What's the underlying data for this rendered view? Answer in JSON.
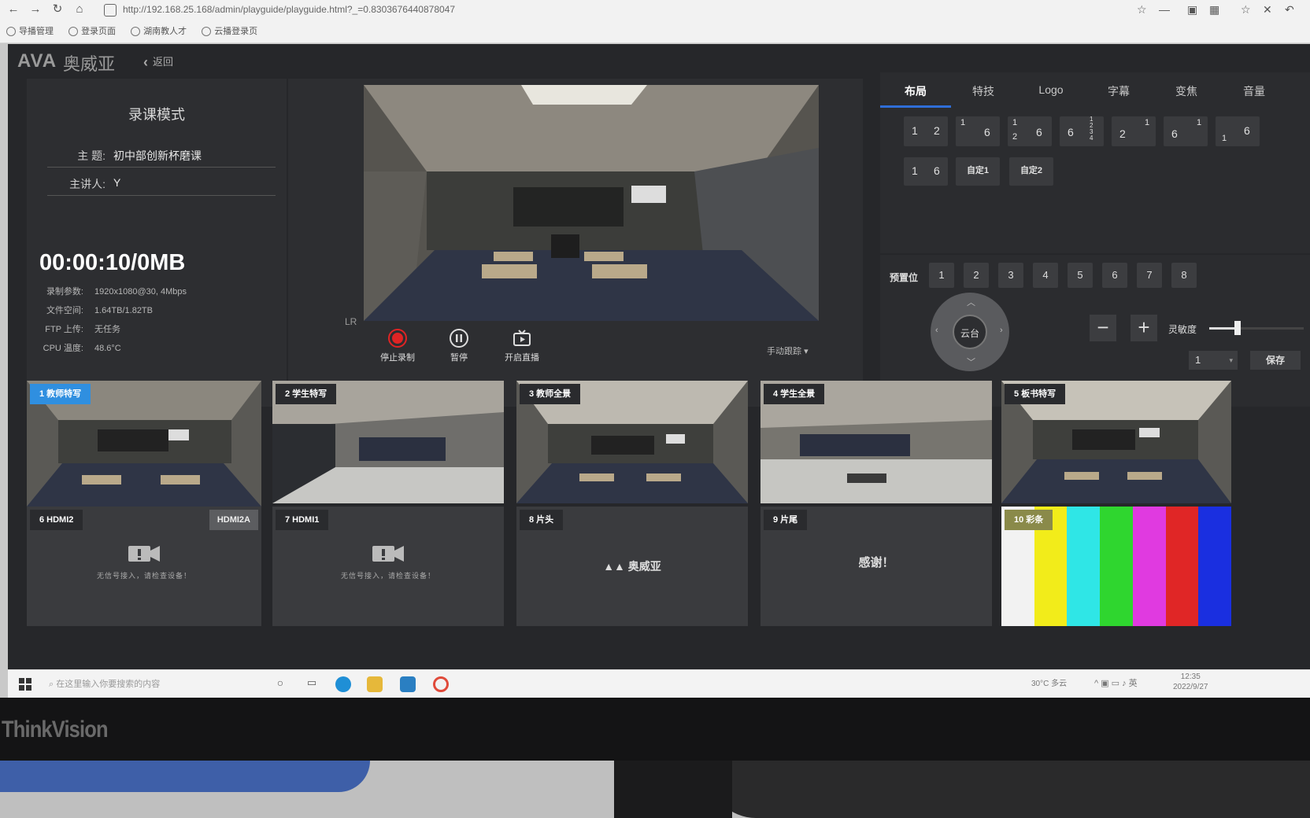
{
  "browser": {
    "url": "http://192.168.25.168/admin/playguide/playguide.html?_=0.8303676440878047",
    "bookmarks": [
      "导播管理",
      "登录页面",
      "湖南教人才",
      "云播登录页"
    ]
  },
  "app": {
    "logo": "AVA",
    "logo_cn": "奥威亚",
    "back_label": "返回"
  },
  "info": {
    "mode_title": "录课模式",
    "topic_label": "主 题:",
    "topic_value": "初中部创新杯磨课",
    "speaker_label": "主讲人:",
    "speaker_value": "Y",
    "timer": "00:00:10/0MB",
    "stats": [
      {
        "k": "录制参数:",
        "v": "1920x1080@30, 4Mbps"
      },
      {
        "k": "文件空间:",
        "v": "1.64TB/1.82TB"
      },
      {
        "k": "FTP 上传:",
        "v": "无任务"
      },
      {
        "k": "CPU 温度:",
        "v": "48.6°C"
      }
    ]
  },
  "preview": {
    "lr_label": "LR",
    "stop_label": "停止录制",
    "pause_label": "暂停",
    "live_label": "开启直播",
    "manual_label": "手动跟踪"
  },
  "tabs": [
    "布局",
    "特技",
    "Logo",
    "字幕",
    "变焦",
    "音量"
  ],
  "layouts": {
    "custom1": "自定1",
    "custom2": "自定2"
  },
  "ptz": {
    "preset_label": "预置位",
    "presets": [
      "1",
      "2",
      "3",
      "4",
      "5",
      "6",
      "7",
      "8"
    ],
    "center_label": "云台",
    "speed_label": "灵敏度",
    "speed_level": 0.3,
    "select_value": "1",
    "save_label": "保存"
  },
  "sources": [
    {
      "label": "1 教师特写",
      "selected": true
    },
    {
      "label": "2 学生特写"
    },
    {
      "label": "3 教师全景"
    },
    {
      "label": "4 学生全景"
    },
    {
      "label": "5 板书特写"
    },
    {
      "label": "6 HDMI2",
      "tag": "HDMI2A",
      "nosignal": "无信号接入，请检查设备！"
    },
    {
      "label": "7 HDMI1",
      "nosignal": "无信号接入，请检查设备！"
    },
    {
      "label": "8 片头",
      "text": "奥威亚"
    },
    {
      "label": "9 片尾",
      "text": "感谢！"
    },
    {
      "label": "10 彩条"
    }
  ],
  "taskbar": {
    "search_placeholder": "在这里输入你要搜索的内容",
    "weather": "30°C 多云",
    "time": "12:35",
    "date": "2022/9/27"
  },
  "monitor": {
    "brand": "ThinkVision"
  },
  "colors": {
    "accent": "#2f6ed8",
    "selected": "#4ec43a",
    "record": "#e02424"
  }
}
